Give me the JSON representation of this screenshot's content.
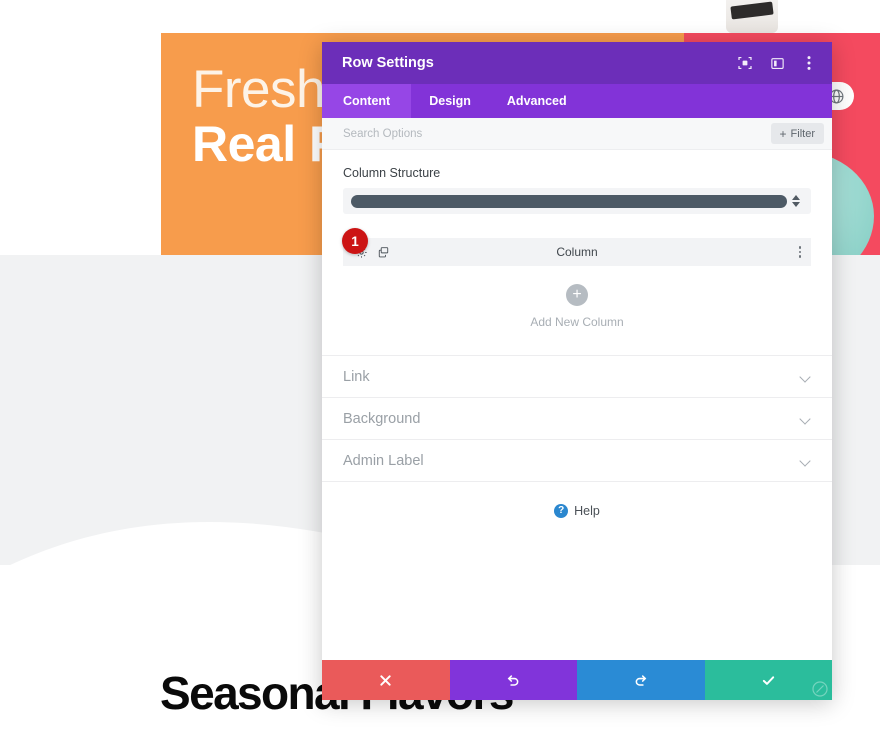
{
  "background": {
    "hero": {
      "line1": "Fresh I",
      "line2": "Real F",
      "globe_icon": "globe-icon"
    },
    "seasonal_title": "Seasonal Flavors",
    "colors": {
      "orange": "#f79c4c",
      "pink": "#f44a5f",
      "gray": "#f1f2f3"
    }
  },
  "modal": {
    "title": "Row Settings",
    "header_icons": [
      {
        "name": "focus-target-icon"
      },
      {
        "name": "panel-layout-icon"
      },
      {
        "name": "kebab-menu-icon"
      }
    ],
    "tabs": [
      {
        "label": "Content",
        "active": true
      },
      {
        "label": "Design",
        "active": false
      },
      {
        "label": "Advanced",
        "active": false
      }
    ],
    "search": {
      "placeholder": "Search Options",
      "value": ""
    },
    "filter": {
      "label": "Filter",
      "plus": "+"
    },
    "column_structure": {
      "label": "Column Structure",
      "selected": "1 Column"
    },
    "column_row": {
      "label": "Column",
      "settings_icon": "gear-icon",
      "duplicate_icon": "duplicate-icon",
      "menu_icon": "kebab-menu-icon",
      "badge": "1"
    },
    "add_column": {
      "label": "Add New Column",
      "plus": "+"
    },
    "toggle_sections": [
      {
        "label": "Link"
      },
      {
        "label": "Background"
      },
      {
        "label": "Admin Label"
      }
    ],
    "help": {
      "label": "Help",
      "icon_char": "?"
    },
    "footer_buttons": [
      {
        "name": "discard-button",
        "icon": "close-x-icon",
        "color": "#ea5a5a"
      },
      {
        "name": "undo-button",
        "icon": "undo-icon",
        "color": "#8134da"
      },
      {
        "name": "redo-button",
        "icon": "redo-icon",
        "color": "#2a8bd5"
      },
      {
        "name": "save-button",
        "icon": "check-icon",
        "color": "#2bbd9c"
      }
    ],
    "colors": {
      "header": "#6c2eb9",
      "tabbar": "#8233d8",
      "tab_active": "#9646e6"
    }
  }
}
